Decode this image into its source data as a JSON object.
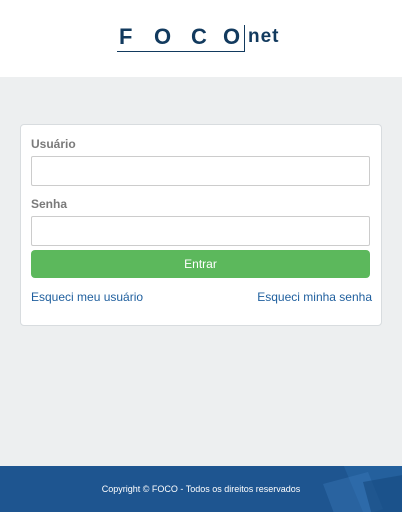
{
  "logo": {
    "letters": [
      "F",
      "O",
      "C",
      "O"
    ],
    "suffix": "net",
    "color": "#123a5e"
  },
  "form": {
    "username_label": "Usuário",
    "username_value": "",
    "password_label": "Senha",
    "password_value": "",
    "submit_label": "Entrar",
    "forgot_username": "Esqueci meu usuário",
    "forgot_password": "Esqueci minha senha",
    "submit_color": "#5cb85c"
  },
  "footer": {
    "copyright": "Copyright © FOCO - Todos os direitos reservados",
    "background": "#1e5590"
  }
}
